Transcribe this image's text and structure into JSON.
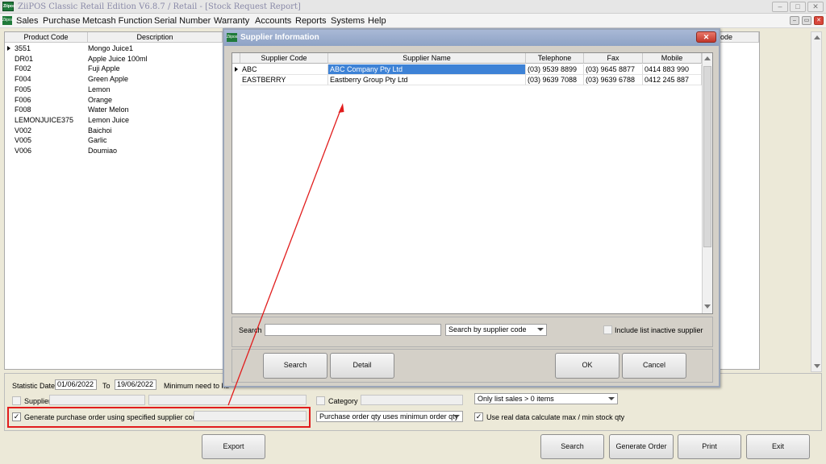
{
  "window": {
    "title": "ZiiPOS Classic Retail Edition V6.8.7 / Retail - [Stock Request Report]",
    "controls": [
      "–",
      "□",
      "✕"
    ]
  },
  "menu": {
    "items": [
      "Sales",
      "Purchase",
      "Metcash Function",
      "Serial Number",
      "Warranty",
      "Accounts",
      "Reports",
      "Systems",
      "Help"
    ]
  },
  "main_grid": {
    "columns": [
      "Product Code",
      "Description",
      "ode"
    ],
    "rows": [
      {
        "code": "3551",
        "desc": "Mongo Juice1"
      },
      {
        "code": "DR01",
        "desc": "Apple Juice 100ml"
      },
      {
        "code": "F002",
        "desc": "Fuji Apple"
      },
      {
        "code": "F004",
        "desc": "Green Apple"
      },
      {
        "code": "F005",
        "desc": "Lemon"
      },
      {
        "code": "F006",
        "desc": "Orange"
      },
      {
        "code": "F008",
        "desc": "Water Melon"
      },
      {
        "code": "LEMONJUICE375",
        "desc": "Lemon Juice"
      },
      {
        "code": "V002",
        "desc": "Baichoi"
      },
      {
        "code": "V005",
        "desc": "Garlic"
      },
      {
        "code": "V006",
        "desc": "Doumiao"
      }
    ]
  },
  "filters": {
    "statistic_date_label": "Statistic Date",
    "date_from": "01/06/2022",
    "to_label": "To",
    "date_to": "19/06/2022",
    "min_need_label": "Minimum need to ku",
    "supplier_label": "Supplier",
    "category_label": "Category",
    "gen_po_label": "Generate purchase order using specified supplier code",
    "only_list_sales": "Only list sales > 0 items",
    "po_qty_mode": "Purchase order qty uses minimun order qty",
    "use_real_data_label": "Use real data calculate max / min stock qty"
  },
  "bottom_buttons": {
    "export": "Export",
    "search": "Search",
    "generate_order": "Generate Order",
    "print": "Print",
    "exit": "Exit"
  },
  "dialog": {
    "title": "Supplier Information",
    "columns": [
      "Supplier Code",
      "Supplier Name",
      "Telephone",
      "Fax",
      "Mobile"
    ],
    "rows": [
      {
        "code": "ABC",
        "name": "ABC Company Pty Ltd",
        "telephone": "(03) 9539 8899",
        "fax": "(03) 9645 8877",
        "mobile": "0414 883 990"
      },
      {
        "code": "EASTBERRY",
        "name": "Eastberry Group Pty Ltd",
        "telephone": "(03) 9639 7088",
        "fax": "(03) 9639 6788",
        "mobile": "0412 245 887"
      }
    ],
    "search_label": "Search",
    "search_value": "",
    "search_mode": "Search by supplier code",
    "include_inactive_label": "Include list inactive supplier",
    "buttons": {
      "search": "Search",
      "detail": "Detail",
      "ok": "OK",
      "cancel": "Cancel"
    }
  },
  "colors": {
    "annotation": "#e11d1d",
    "selection": "#3d82d6",
    "dialog_title": "#8ea2c5"
  }
}
